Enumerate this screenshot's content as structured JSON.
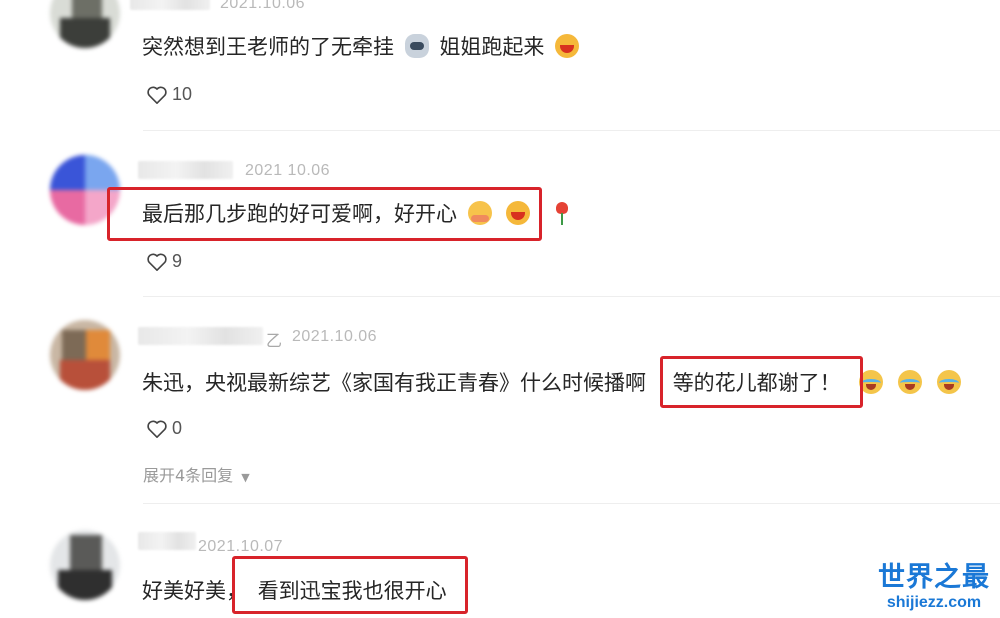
{
  "comments": [
    {
      "date": "2021.10.06",
      "text": "突然想到王老师的了无牵挂",
      "text_after": "姐姐跑起来",
      "likes": "10",
      "emojis": [
        "cat-emoji",
        "laughing-emoji"
      ]
    },
    {
      "date": "2021 10.06",
      "text": "最后那几步跑的好可爱啊，好开心",
      "likes": "9",
      "emojis": [
        "hug-emoji",
        "laughing-emoji",
        "rose-emoji"
      ]
    },
    {
      "name_suffix": "乙",
      "date": "2021.10.06",
      "text": "朱迅，央视最新综艺《家国有我正青春》什么时候播啊",
      "text_highlight": "等的花儿都谢了！",
      "likes": "0",
      "expand": "展开4条回复",
      "emojis": [
        "tears-of-joy-emoji",
        "tears-of-joy-emoji",
        "tears-of-joy-emoji"
      ]
    },
    {
      "date": "2021.10.07",
      "text": "好美好美，",
      "text_highlight": "看到迅宝我也很开心"
    }
  ],
  "watermark": {
    "title": "世界之最",
    "url": "shijiezz.com"
  },
  "colors": {
    "highlight_box": "#d8232a",
    "watermark": "#1a78d6"
  }
}
